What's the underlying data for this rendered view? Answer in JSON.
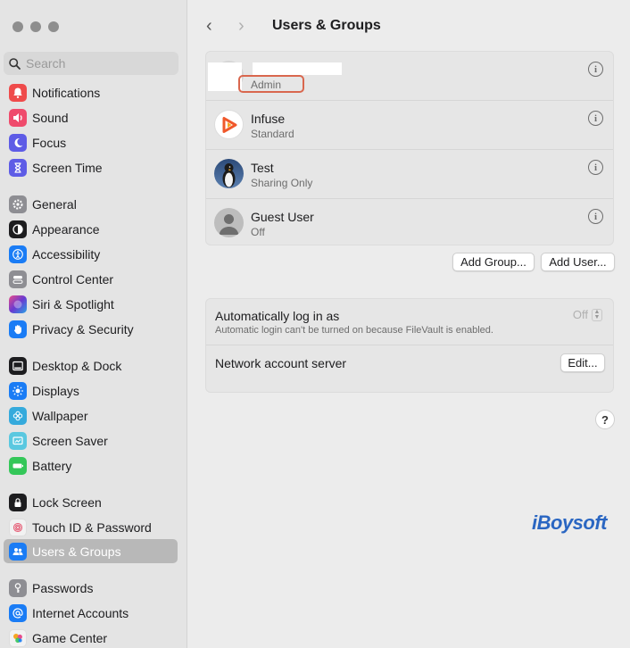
{
  "sidebar": {
    "search_placeholder": "Search",
    "items": [
      {
        "label": "Notifications",
        "icon": "bell-icon",
        "color": "#ef4b4b"
      },
      {
        "label": "Sound",
        "icon": "speaker-icon",
        "color": "#ef4b6c"
      },
      {
        "label": "Focus",
        "icon": "moon-icon",
        "color": "#5e5ce6"
      },
      {
        "label": "Screen Time",
        "icon": "hourglass-icon",
        "color": "#5e5ce6"
      },
      {
        "label": "General",
        "icon": "gear-icon",
        "color": "#8e8e93"
      },
      {
        "label": "Appearance",
        "icon": "appearance-icon",
        "color": "#1d1d1f"
      },
      {
        "label": "Accessibility",
        "icon": "accessibility-icon",
        "color": "#1a7cf5"
      },
      {
        "label": "Control Center",
        "icon": "control-center-icon",
        "color": "#8e8e93"
      },
      {
        "label": "Siri & Spotlight",
        "icon": "siri-icon",
        "color": "#8a3ab9"
      },
      {
        "label": "Privacy & Security",
        "icon": "hand-icon",
        "color": "#1a7cf5"
      },
      {
        "label": "Desktop & Dock",
        "icon": "dock-icon",
        "color": "#1d1d1f"
      },
      {
        "label": "Displays",
        "icon": "sun-icon",
        "color": "#1a7cf5"
      },
      {
        "label": "Wallpaper",
        "icon": "flower-icon",
        "color": "#35aadc"
      },
      {
        "label": "Screen Saver",
        "icon": "screensaver-icon",
        "color": "#5ac8e0"
      },
      {
        "label": "Battery",
        "icon": "battery-icon",
        "color": "#34c759"
      },
      {
        "label": "Lock Screen",
        "icon": "lock-icon",
        "color": "#1d1d1f"
      },
      {
        "label": "Touch ID & Password",
        "icon": "fingerprint-icon",
        "color": "#f2f2f2"
      },
      {
        "label": "Users & Groups",
        "icon": "users-icon",
        "color": "#1a7cf5"
      },
      {
        "label": "Passwords",
        "icon": "key-icon",
        "color": "#8e8e93"
      },
      {
        "label": "Internet Accounts",
        "icon": "at-icon",
        "color": "#1a7cf5"
      },
      {
        "label": "Game Center",
        "icon": "game-center-icon",
        "color": "#f2f2f2"
      }
    ]
  },
  "header": {
    "back": "‹",
    "forward": "›",
    "title": "Users & Groups"
  },
  "users": [
    {
      "name": "",
      "role": "Admin",
      "avatar": "redacted"
    },
    {
      "name": "Infuse",
      "role": "Standard",
      "avatar": "infuse-icon"
    },
    {
      "name": "Test",
      "role": "Sharing Only",
      "avatar": "penguin-avatar"
    },
    {
      "name": "Guest User",
      "role": "Off",
      "avatar": "guest-avatar"
    }
  ],
  "info_glyph": "i",
  "buttons": {
    "add_group": "Add Group...",
    "add_user": "Add User..."
  },
  "settings": {
    "auto_login_label": "Automatically log in as",
    "auto_login_sub": "Automatic login can't be turned on because FileVault is enabled.",
    "auto_login_value": "Off",
    "network_label": "Network account server",
    "network_button": "Edit..."
  },
  "help": "?",
  "watermark": "iBoysoft"
}
